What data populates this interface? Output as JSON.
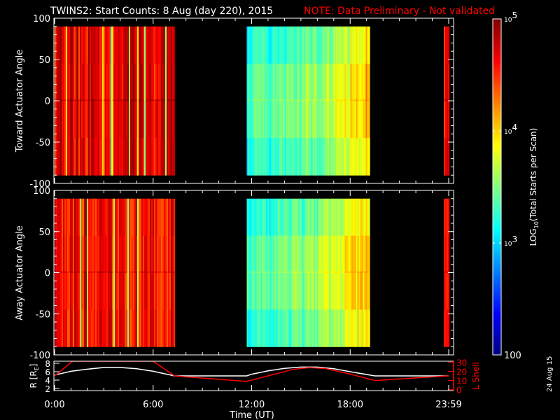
{
  "title": {
    "main": "TWINS2: Start Counts:  8 Aug (day 220), 2015",
    "note": "NOTE: Data Preliminary - Not validated",
    "note_color": "#ff0000"
  },
  "stamp": "24 Aug 15",
  "chart_data": [
    {
      "type": "heatmap",
      "name": "toward",
      "ylabel": "Toward Actuator Angle",
      "ylim": [
        -100,
        100
      ],
      "yticks": [
        "100",
        "50",
        "0",
        "-50",
        "-100"
      ],
      "data_angle_range": [
        -90,
        90
      ],
      "coverage_hours": [
        [
          0,
          7.3
        ],
        [
          11.7,
          19.2
        ],
        [
          23.7,
          24
        ]
      ],
      "block_log_counts": [
        4.7,
        3.3,
        4.6
      ],
      "block_log_counts_end": [
        4.7,
        4.1,
        4.6
      ]
    },
    {
      "type": "heatmap",
      "name": "away",
      "ylabel": "Away Actuator Angle",
      "ylim": [
        -100,
        100
      ],
      "yticks": [
        "100",
        "50",
        "0",
        "-50",
        "-100"
      ],
      "data_angle_range": [
        -90,
        90
      ],
      "coverage_hours": [
        [
          0,
          7.3
        ],
        [
          11.7,
          19.2
        ],
        [
          23.7,
          24
        ]
      ],
      "block_log_counts": [
        4.6,
        3.3,
        4.6
      ],
      "block_log_counts_end": [
        4.6,
        4.1,
        4.6
      ]
    },
    {
      "type": "line",
      "name": "orbit",
      "xlabel": "Time (UT)",
      "xticks": [
        "0:00",
        "6:00",
        "12:00",
        "18:00",
        "23:59"
      ],
      "ylabel": "R [R",
      "ylabel_sub": "E",
      "ylabel_end": "]",
      "ylim": [
        1.5,
        8.5
      ],
      "yticks": [
        "8",
        "6",
        "4",
        "2"
      ],
      "y2label": "L Shell",
      "y2lim": [
        0,
        30
      ],
      "y2ticks": [
        "30",
        "20",
        "10",
        "0"
      ],
      "series": [
        {
          "name": "R",
          "color": "#ffffff",
          "x": [
            0,
            1,
            2,
            3,
            4,
            5,
            6,
            7.3,
            11.7,
            12,
            13,
            14,
            15,
            16,
            17,
            18,
            19.5,
            24
          ],
          "y": [
            5.2,
            6.1,
            6.6,
            7.0,
            7.0,
            6.7,
            6.1,
            5.0,
            5.0,
            5.4,
            6.2,
            6.8,
            7.1,
            7.1,
            6.7,
            6.0,
            5.0,
            5.0
          ]
        },
        {
          "name": "L Shell",
          "color": "#ff0000",
          "x": [
            0,
            1.1,
            6.0,
            7.3,
            11.7,
            13,
            14.5,
            15.5,
            16.5,
            18,
            19.5,
            24
          ],
          "y": [
            15,
            31,
            31,
            15,
            9,
            15,
            22,
            24,
            23,
            17,
            10,
            15
          ]
        }
      ]
    },
    {
      "type": "colorbar",
      "label": "LOG",
      "label_sub": "10",
      "label_end": "(Total Starts per Scan)",
      "ticks": [
        {
          "base": "10",
          "exp": "5",
          "value": 5
        },
        {
          "base": "10",
          "exp": "4",
          "value": 4
        },
        {
          "base": "10",
          "exp": "3",
          "value": 3
        },
        {
          "base": "100",
          "exp": "",
          "value": 2
        }
      ],
      "range": [
        2,
        5
      ]
    }
  ]
}
